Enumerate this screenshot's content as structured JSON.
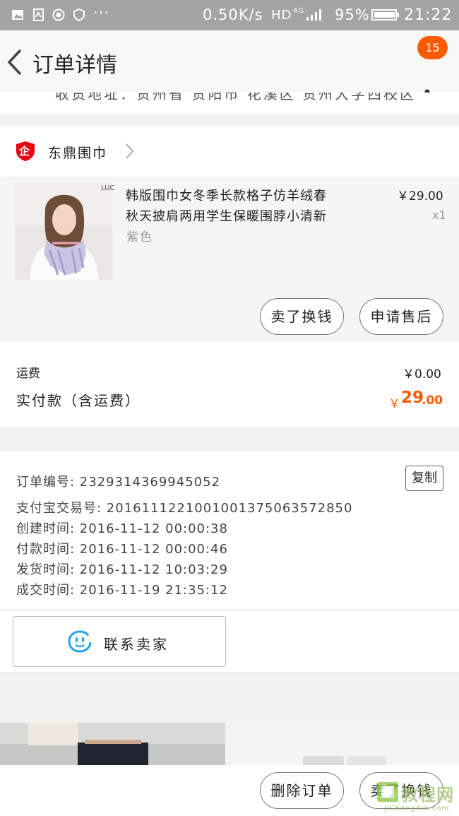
{
  "status_bar": {
    "network_speed": "0.50K/s",
    "hd": "HD",
    "net_type": "4G",
    "battery": "95%",
    "time": "21:22"
  },
  "nav": {
    "title": "订单详情",
    "badge_count": "15"
  },
  "address_partial": "收货地址：贵州省 贵阳市 花溪区 贵州大学西校区",
  "shop": {
    "icon_char": "企",
    "name": "东鼎围巾"
  },
  "product": {
    "title_line1": "韩版围巾女冬季长款格子仿羊绒春",
    "title_line2": "秋天披肩两用学生保暖围脖小清新",
    "variant": "紫色",
    "price": "￥29.00",
    "quantity": "x1",
    "image_tag": "LUC"
  },
  "product_actions": {
    "sell_label": "卖了换钱",
    "after_sale_label": "申请售后"
  },
  "fees": {
    "shipping_label": "运费",
    "shipping_value": "￥0.00",
    "total_label": "实付款（含运费）",
    "total_currency": "￥",
    "total_int": "29",
    "total_dec": ".00"
  },
  "order_info": {
    "order_no": "订单编号: 2329314369945052",
    "copy_label": "复制",
    "alipay_no": "支付宝交易号: 2016111221001001375063572850",
    "created": "创建时间: 2016-11-12 00:00:38",
    "paid": "付款时间: 2016-11-12 00:00:46",
    "shipped": "发货时间: 2016-11-12 10:03:29",
    "completed": "成交时间: 2016-11-19 21:35:12"
  },
  "contact": {
    "label": "联系卖家"
  },
  "bottom_actions": {
    "delete_label": "删除订单",
    "sell_label": "卖了换钱"
  },
  "watermark": {
    "brand": "教程网",
    "url": "JiChengXin.com"
  },
  "colors": {
    "accent": "#ff5a00",
    "shop_red": "#e60012",
    "contact_blue": "#27a3ec"
  }
}
